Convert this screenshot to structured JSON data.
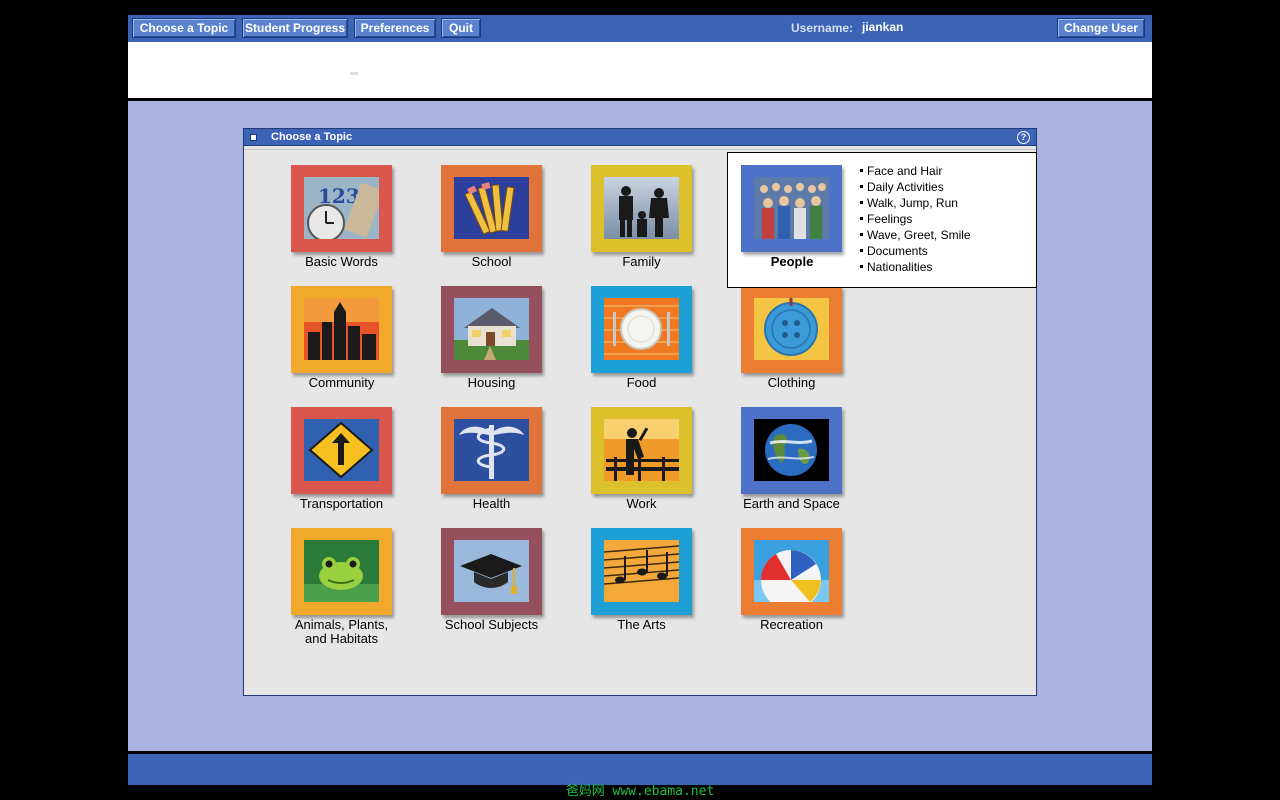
{
  "toolbar": {
    "choose_topic": "Choose a Topic",
    "student_progress": "Student Progress",
    "preferences": "Preferences",
    "quit": "Quit",
    "username_label": "Username:",
    "username": "jiankan",
    "change_user": "Change User"
  },
  "panel": {
    "title": "Choose a Topic",
    "help": "?"
  },
  "topics": [
    {
      "label": "Basic Words",
      "frame_color": "#d9574c",
      "icon": "basic-words-icon"
    },
    {
      "label": "School",
      "frame_color": "#e0743a",
      "icon": "school-icon"
    },
    {
      "label": "Family",
      "frame_color": "#dcc12c",
      "icon": "family-icon"
    },
    {
      "label": "People",
      "frame_color": "#4d72c8",
      "icon": "people-icon"
    },
    {
      "label": "Community",
      "frame_color": "#f0a92a",
      "icon": "community-icon"
    },
    {
      "label": "Housing",
      "frame_color": "#94505c",
      "icon": "housing-icon"
    },
    {
      "label": "Food",
      "frame_color": "#1ea0d6",
      "icon": "food-icon"
    },
    {
      "label": "Clothing",
      "frame_color": "#ec7d32",
      "icon": "clothing-icon"
    },
    {
      "label": "Transportation",
      "frame_color": "#d9574c",
      "icon": "transportation-icon"
    },
    {
      "label": "Health",
      "frame_color": "#e0743a",
      "icon": "health-icon"
    },
    {
      "label": "Work",
      "frame_color": "#dcc12c",
      "icon": "work-icon"
    },
    {
      "label": "Earth and Space",
      "frame_color": "#4d72c8",
      "icon": "earth-icon"
    },
    {
      "label": "Animals, Plants,\nand Habitats",
      "frame_color": "#f0a92a",
      "icon": "frog-icon"
    },
    {
      "label": "School Subjects",
      "frame_color": "#94505c",
      "icon": "graduation-cap-icon"
    },
    {
      "label": "The Arts",
      "frame_color": "#1ea0d6",
      "icon": "music-icon"
    },
    {
      "label": "Recreation",
      "frame_color": "#ec7d32",
      "icon": "beach-ball-icon"
    }
  ],
  "popup": {
    "title": "People",
    "items": [
      "Face and Hair",
      "Daily Activities",
      "Walk, Jump, Run",
      "Feelings",
      "Wave, Greet, Smile",
      "Documents",
      "Nationalities"
    ]
  },
  "watermark": "爸妈网 www.ebama.net"
}
